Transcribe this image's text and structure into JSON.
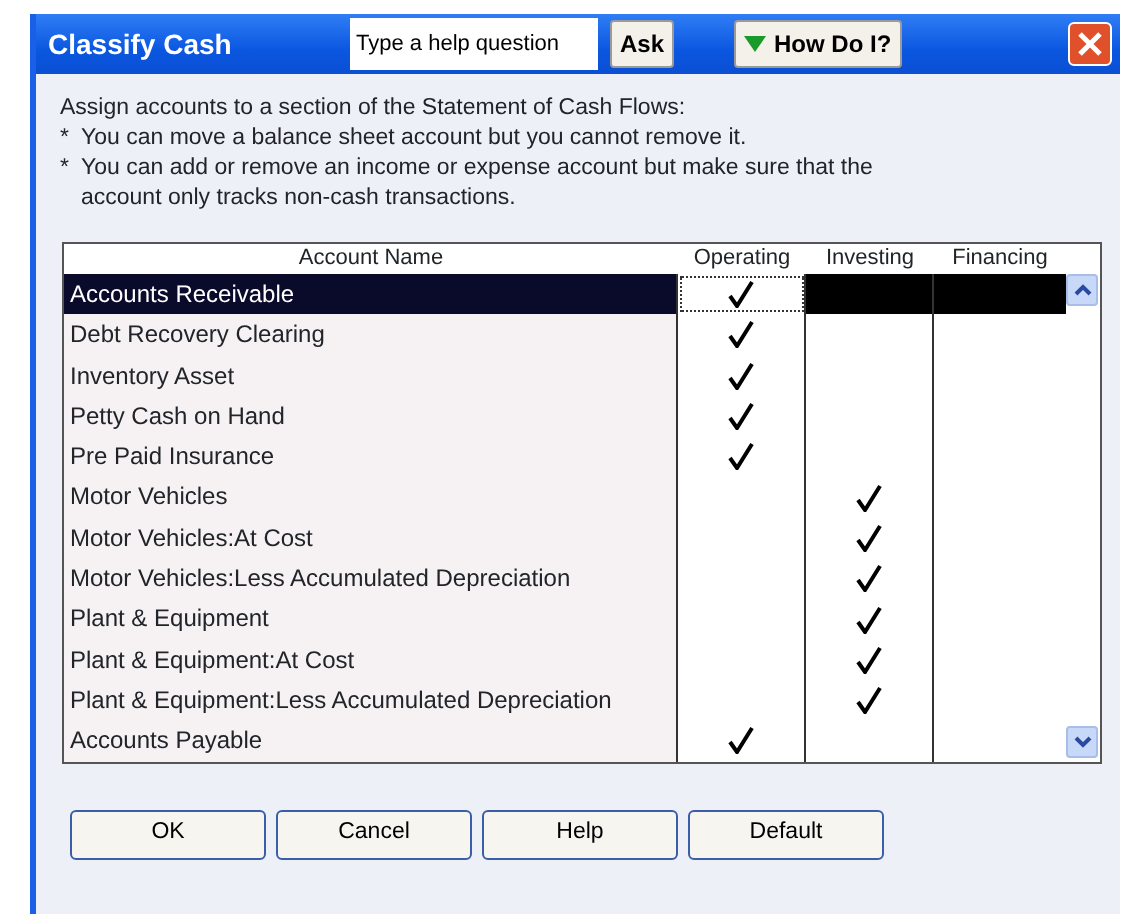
{
  "window": {
    "title": "Classify Cash"
  },
  "help": {
    "placeholder": "Type a help question",
    "ask_button": "Ask",
    "how_do_i_button": "How Do I?"
  },
  "instructions": {
    "intro": "Assign accounts to a section of the Statement of Cash Flows:",
    "bullets": [
      {
        "mark": "*",
        "text": "You can move a balance sheet account but you cannot remove it."
      },
      {
        "mark": "*",
        "text": "You can add or remove an income or expense account but make sure that the account only tracks non-cash transactions."
      }
    ]
  },
  "table": {
    "columns": [
      "Account Name",
      "Operating",
      "Investing",
      "Financing"
    ],
    "rows": [
      {
        "name": "Accounts Receivable",
        "operating": true,
        "investing": false,
        "financing": false,
        "selected": true
      },
      {
        "name": "Debt Recovery Clearing",
        "operating": true,
        "investing": false,
        "financing": false,
        "selected": false
      },
      {
        "name": "Inventory Asset",
        "operating": true,
        "investing": false,
        "financing": false,
        "selected": false
      },
      {
        "name": "Petty Cash on Hand",
        "operating": true,
        "investing": false,
        "financing": false,
        "selected": false
      },
      {
        "name": "Pre Paid Insurance",
        "operating": true,
        "investing": false,
        "financing": false,
        "selected": false
      },
      {
        "name": "Motor Vehicles",
        "operating": false,
        "investing": true,
        "financing": false,
        "selected": false
      },
      {
        "name": "Motor Vehicles:At Cost",
        "operating": false,
        "investing": true,
        "financing": false,
        "selected": false
      },
      {
        "name": "Motor Vehicles:Less Accumulated Depreciation",
        "operating": false,
        "investing": true,
        "financing": false,
        "selected": false
      },
      {
        "name": "Plant & Equipment",
        "operating": false,
        "investing": true,
        "financing": false,
        "selected": false
      },
      {
        "name": "Plant & Equipment:At Cost",
        "operating": false,
        "investing": true,
        "financing": false,
        "selected": false
      },
      {
        "name": "Plant & Equipment:Less Accumulated Depreciation",
        "operating": false,
        "investing": true,
        "financing": false,
        "selected": false
      },
      {
        "name": "Accounts Payable",
        "operating": true,
        "investing": false,
        "financing": false,
        "selected": false
      }
    ]
  },
  "buttons": [
    "OK",
    "Cancel",
    "Help",
    "Default"
  ]
}
